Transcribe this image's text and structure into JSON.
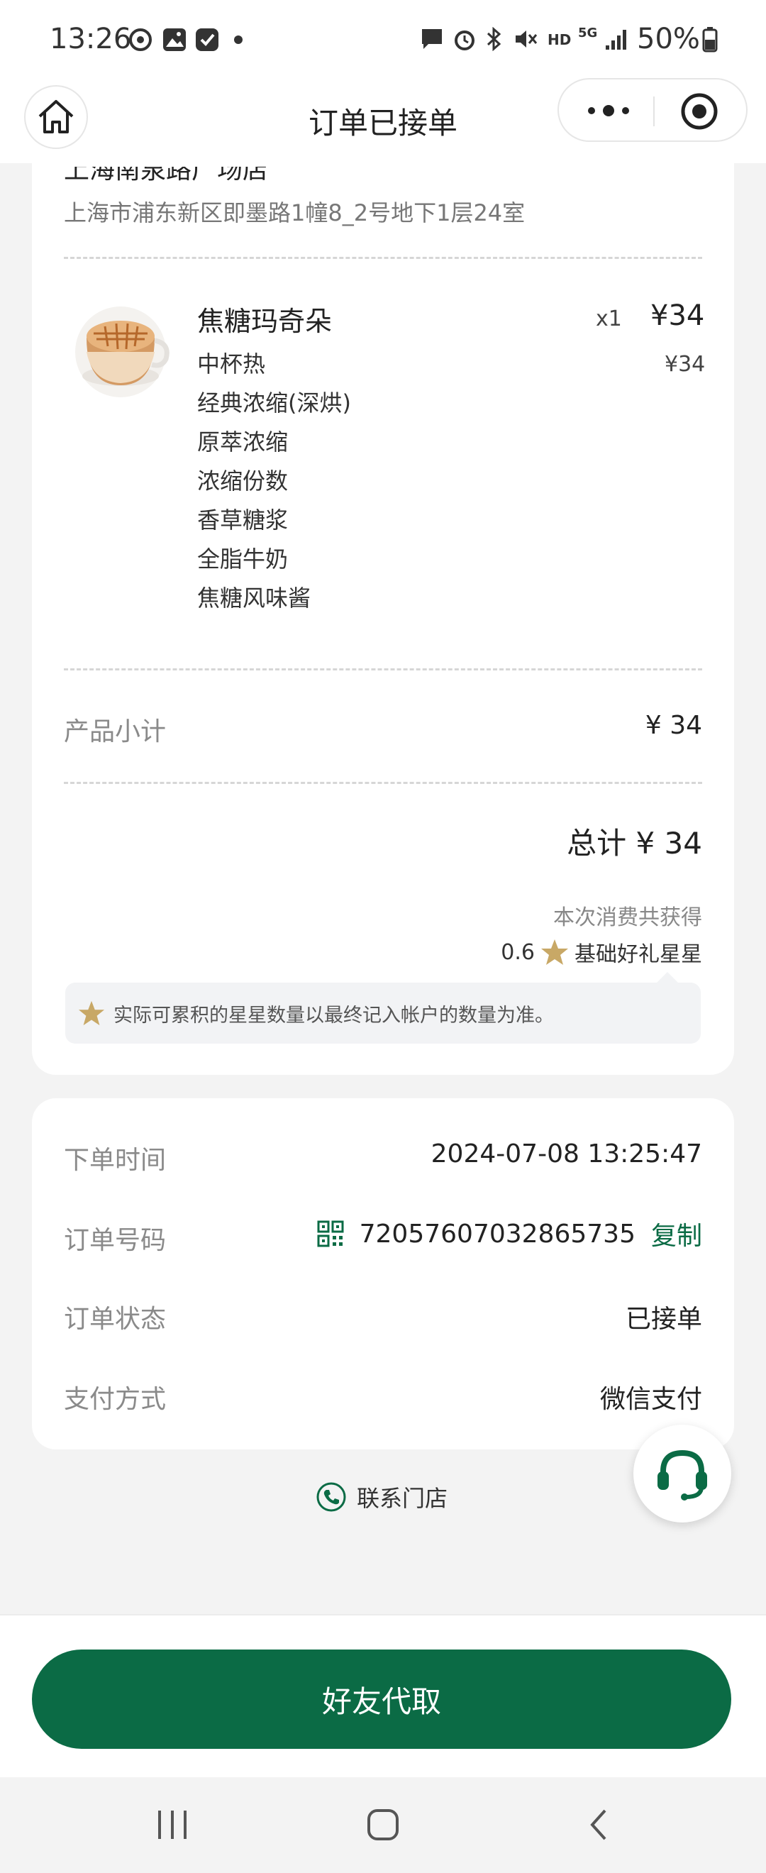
{
  "status_bar": {
    "time": "13:26",
    "battery": "50%",
    "network": "5G",
    "hd": "HD",
    "icons": [
      "weibo-icon",
      "gallery-icon",
      "app-badge-icon",
      "notification-dot-icon",
      "chat-icon",
      "alarm-icon",
      "bluetooth-icon",
      "mute-icon",
      "hd-icon",
      "signal-5g-icon",
      "signal-bars-icon",
      "battery-icon"
    ]
  },
  "header": {
    "title": "订单已接单",
    "home_icon": "home-icon",
    "more_icon": "more-dots-icon",
    "close_icon": "target-circle-icon"
  },
  "order": {
    "store_name": "上海南泉路广场店",
    "store_address": "上海市浦东新区即墨路1幢8_2号地下1层24室",
    "product": {
      "name": "焦糖玛奇朵",
      "quantity": "x1",
      "price": "¥34",
      "option_price": "¥34",
      "options": [
        "中杯热",
        "经典浓缩(深烘)",
        "原萃浓缩",
        "浓缩份数",
        "香草糖浆",
        "全脂牛奶",
        "焦糖风味酱"
      ]
    },
    "subtotal_label": "产品小计",
    "subtotal_value": "¥ 34",
    "total": "总计 ¥ 34",
    "earn_text": "本次消费共获得",
    "stars_value": "0.6",
    "stars_label": "基础好礼星星",
    "note": "实际可累积的星星数量以最终记入帐户的数量为准。"
  },
  "info": {
    "order_time_label": "下单时间",
    "order_time_value": "2024-07-08 13:25:47",
    "order_number_label": "订单号码",
    "order_number_value": "72057607032865735",
    "copy_label": "复制",
    "order_status_label": "订单状态",
    "order_status_value": "已接单",
    "payment_label": "支付方式",
    "payment_value": "微信支付"
  },
  "contact_store_label": "联系门店",
  "bottom_button_label": "好友代取",
  "colors": {
    "brand_green": "#0b6b45",
    "star_gold": "#c8a866",
    "background": "#f3f3f3"
  }
}
